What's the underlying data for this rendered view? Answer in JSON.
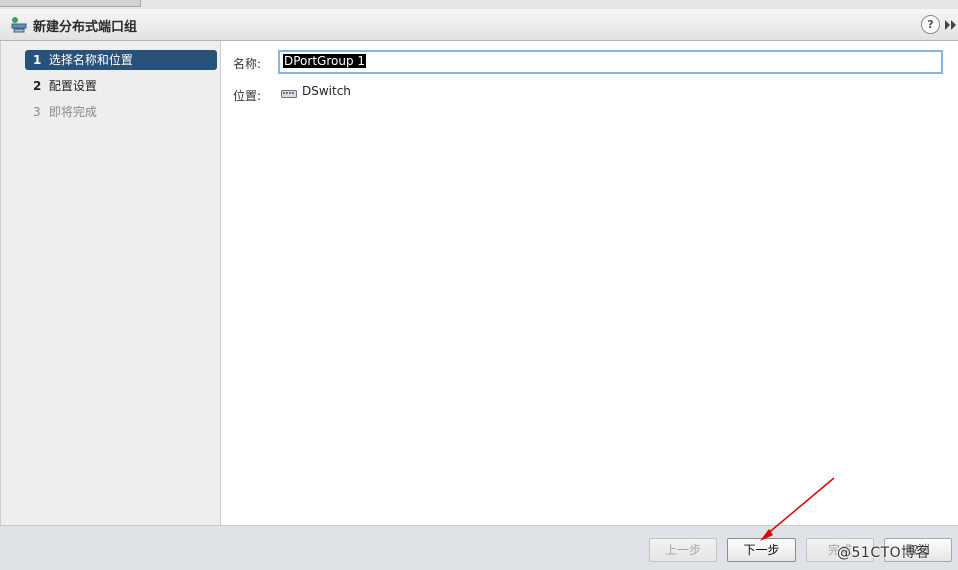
{
  "dialog": {
    "title": "新建分布式端口组",
    "help_label": "?",
    "title_icon": "portgroup-icon",
    "expand_icon": "double-chevron-right-icon"
  },
  "steps": [
    {
      "num": "1",
      "label": "选择名称和位置",
      "state": "active"
    },
    {
      "num": "2",
      "label": "配置设置",
      "state": "normal"
    },
    {
      "num": "3",
      "label": "即将完成",
      "state": "disabled"
    }
  ],
  "form": {
    "name_label": "名称:",
    "name_value": "DPortGroup 1",
    "location_label": "位置:",
    "location_value": "DSwitch",
    "location_icon": "switch-icon"
  },
  "footer": {
    "back_label": "上一步",
    "next_label": "下一步",
    "finish_label": "完成",
    "cancel_label": "取消"
  },
  "watermark": "@51CTO博客",
  "colors": {
    "active_step": "#28527a",
    "input_focus_border": "#84b7d9",
    "annotation_arrow": "#e00000"
  }
}
